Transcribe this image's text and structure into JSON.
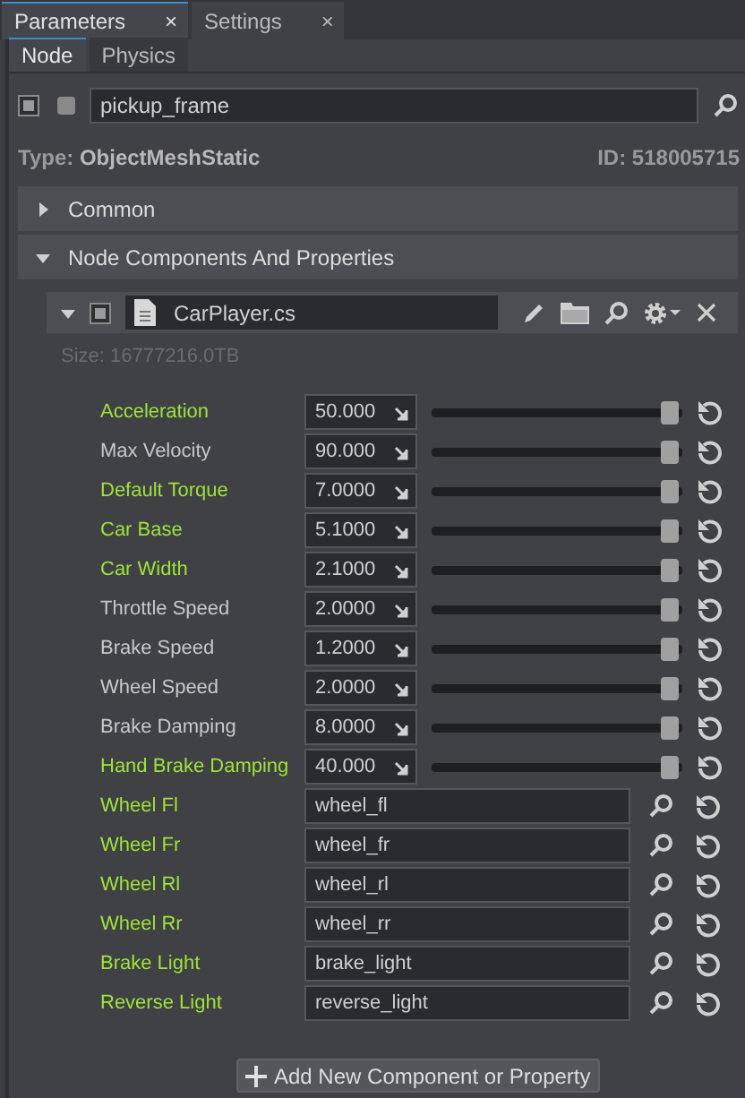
{
  "tabs": [
    {
      "label": "Parameters",
      "close": "×",
      "selected": true
    },
    {
      "label": "Settings",
      "close": "×",
      "selected": false
    }
  ],
  "subtabs": [
    {
      "label": "Node",
      "selected": true
    },
    {
      "label": "Physics",
      "selected": false
    }
  ],
  "node": {
    "enabled": true,
    "name": "pickup_frame",
    "type_label": "Type:",
    "type": "ObjectMeshStatic",
    "id_label": "ID:",
    "id": "518005715"
  },
  "sections": [
    {
      "title": "Common",
      "expanded": false
    },
    {
      "title": "Node Components And Properties",
      "expanded": true
    }
  ],
  "component": {
    "expanded": true,
    "enabled": true,
    "file": "CarPlayer.cs",
    "size": "Size: 16777216.0TB"
  },
  "params": [
    {
      "kind": "number",
      "label": "Acceleration",
      "modified": true,
      "value": "50.000",
      "level": 1
    },
    {
      "kind": "number",
      "label": "Max Velocity",
      "modified": false,
      "value": "90.000",
      "level": 1
    },
    {
      "kind": "number",
      "label": "Default Torque",
      "modified": true,
      "value": "7.0000",
      "level": 1
    },
    {
      "kind": "number",
      "label": "Car Base",
      "modified": true,
      "value": "5.1000",
      "level": 1
    },
    {
      "kind": "number",
      "label": "Car Width",
      "modified": true,
      "value": "2.1000",
      "level": 1
    },
    {
      "kind": "number",
      "label": "Throttle Speed",
      "modified": false,
      "value": "2.0000",
      "level": 1
    },
    {
      "kind": "number",
      "label": "Brake Speed",
      "modified": false,
      "value": "1.2000",
      "level": 1
    },
    {
      "kind": "number",
      "label": "Wheel Speed",
      "modified": false,
      "value": "2.0000",
      "level": 1
    },
    {
      "kind": "number",
      "label": "Brake Damping",
      "modified": false,
      "value": "8.0000",
      "level": 1
    },
    {
      "kind": "number",
      "label": "Hand Brake Damping",
      "modified": true,
      "value": "40.000",
      "level": 1
    },
    {
      "kind": "object",
      "label": "Wheel Fl",
      "modified": true,
      "value": "wheel_fl"
    },
    {
      "kind": "object",
      "label": "Wheel Fr",
      "modified": true,
      "value": "wheel_fr"
    },
    {
      "kind": "object",
      "label": "Wheel Rl",
      "modified": true,
      "value": "wheel_rl"
    },
    {
      "kind": "object",
      "label": "Wheel Rr",
      "modified": true,
      "value": "wheel_rr"
    },
    {
      "kind": "object",
      "label": "Brake Light",
      "modified": true,
      "value": "brake_light"
    },
    {
      "kind": "object",
      "label": "Reverse Light",
      "modified": true,
      "value": "reverse_light"
    }
  ],
  "add_button": "Add New Component or Property"
}
